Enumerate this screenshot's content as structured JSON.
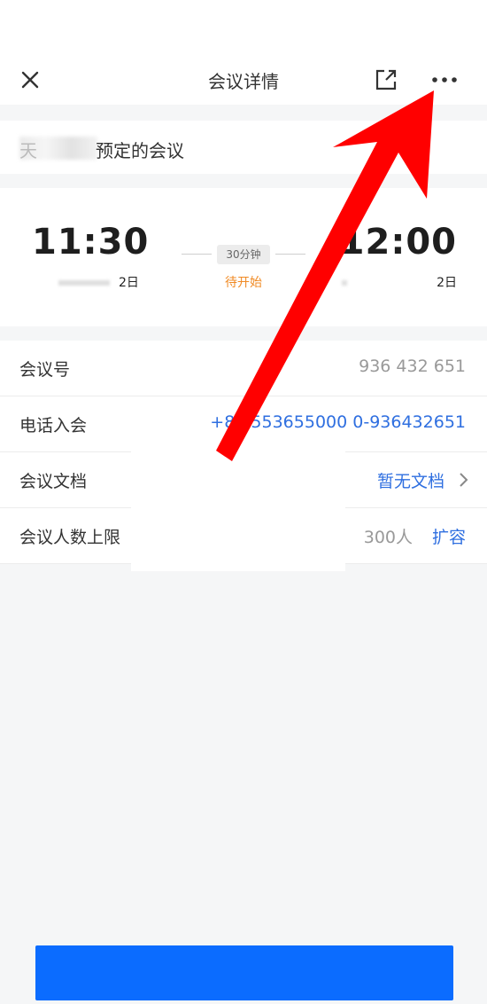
{
  "header": {
    "title": "会议详情"
  },
  "organizer": {
    "prefix": "天",
    "text": "预定的会议"
  },
  "schedule": {
    "start_time": "11:30",
    "end_time": "12:00",
    "start_date": "2日",
    "end_date": "2日",
    "duration": "30分钟",
    "status": "待开始"
  },
  "info": {
    "meeting_id_label": "会议号",
    "meeting_id_value": "936 432 651",
    "phone_label": "电话入会",
    "phone_value": "+86 553655000 0-936432651",
    "docs_label": "会议文档",
    "docs_value": "暂无文档",
    "capacity_label": "会议人数上限",
    "capacity_value": "300人",
    "expand_label": "扩容"
  },
  "colors": {
    "accent": "#2f6fe0",
    "status": "#f08a24",
    "bottom_button": "#0b6cff",
    "annotation_arrow": "#ff0000"
  }
}
